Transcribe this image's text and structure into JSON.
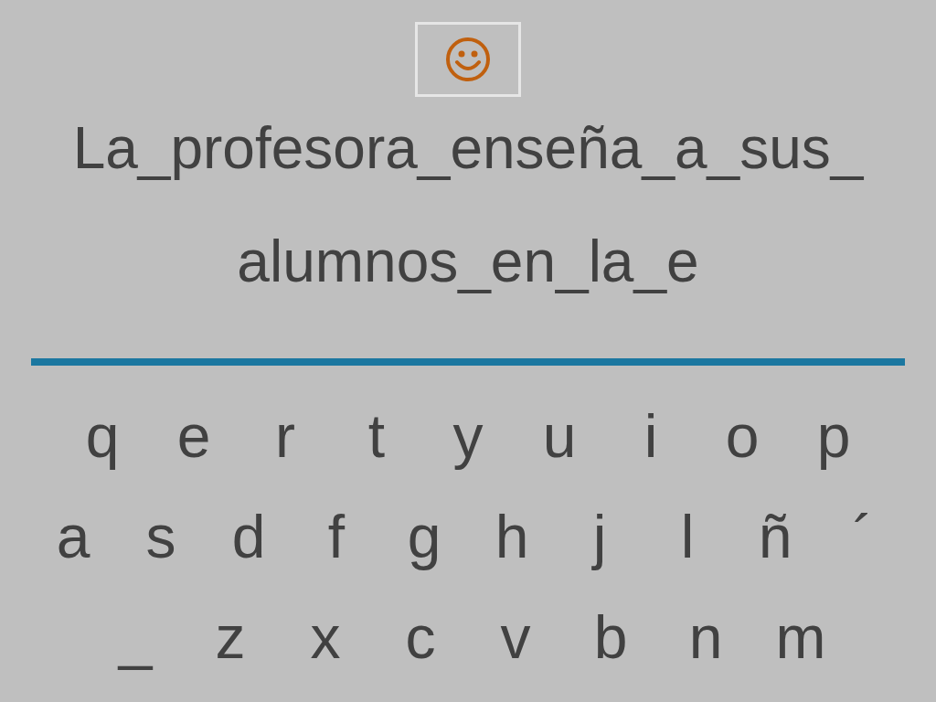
{
  "sentence_lines": [
    "La_profesora_enseña_a_sus_",
    "alumnos_en_la_e"
  ],
  "keyboard": {
    "rows": [
      [
        "q",
        "e",
        "r",
        "t",
        "y",
        "u",
        "i",
        "o",
        "p"
      ],
      [
        "a",
        "s",
        "d",
        "f",
        "g",
        "h",
        "j",
        "l",
        "ñ",
        "´"
      ],
      [
        "_",
        "z",
        "x",
        "c",
        "v",
        "b",
        "n",
        "m"
      ]
    ]
  }
}
